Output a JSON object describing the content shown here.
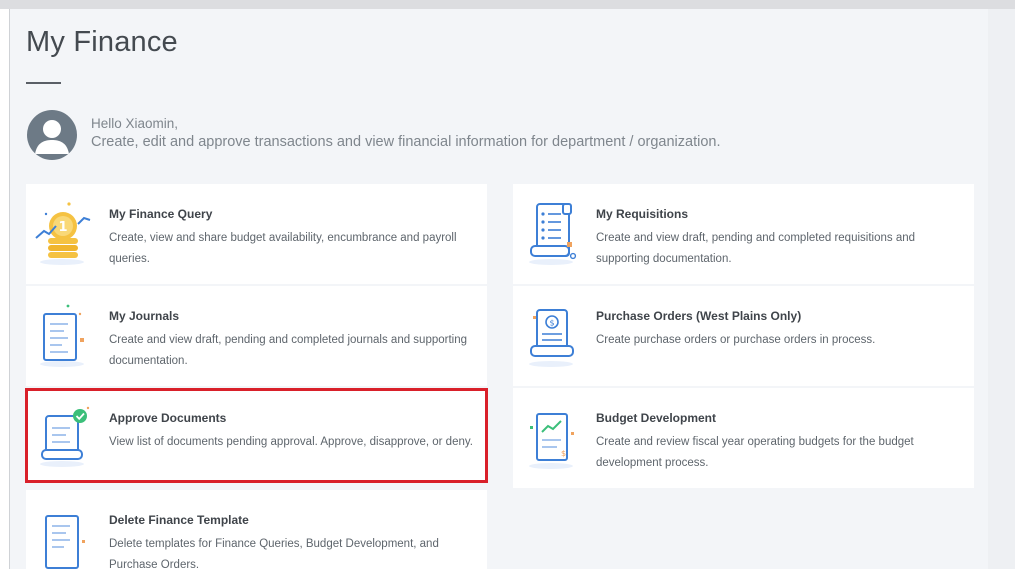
{
  "header": {
    "title": "My Finance"
  },
  "user": {
    "greeting": "Hello Xiaomin,",
    "intro": "Create, edit and approve transactions and view financial information for department / organization."
  },
  "cards": [
    {
      "title": "My Finance Query",
      "description": "Create, view and share budget availability, encumbrance and payroll queries.",
      "icon": "coins-chart-icon"
    },
    {
      "title": "My Requisitions",
      "description": "Create and view draft, pending and completed requisitions and supporting documentation.",
      "icon": "requisition-scroll-icon"
    },
    {
      "title": "My Journals",
      "description": "Create and view draft, pending and completed journals and supporting documentation.",
      "icon": "journal-document-icon"
    },
    {
      "title": "Purchase Orders (West Plains Only)",
      "description": "Create purchase orders or purchase orders in process.",
      "icon": "purchase-order-icon"
    },
    {
      "title": "Approve Documents",
      "description": "View list of documents pending approval. Approve, disapprove, or deny.",
      "icon": "approve-document-icon"
    },
    {
      "title": "Budget Development",
      "description": "Create and review fiscal year operating budgets for the budget development process.",
      "icon": "budget-chart-icon"
    },
    {
      "title": "Delete Finance Template",
      "description": "Delete templates for Finance Queries, Budget Development, and Purchase Orders.",
      "icon": "template-document-icon"
    }
  ],
  "colors": {
    "highlight": "#d9202a",
    "icon_blue": "#3d7fd6",
    "icon_yellow": "#f5c242",
    "icon_orange": "#f0a35e",
    "icon_green": "#3bbf7a"
  }
}
